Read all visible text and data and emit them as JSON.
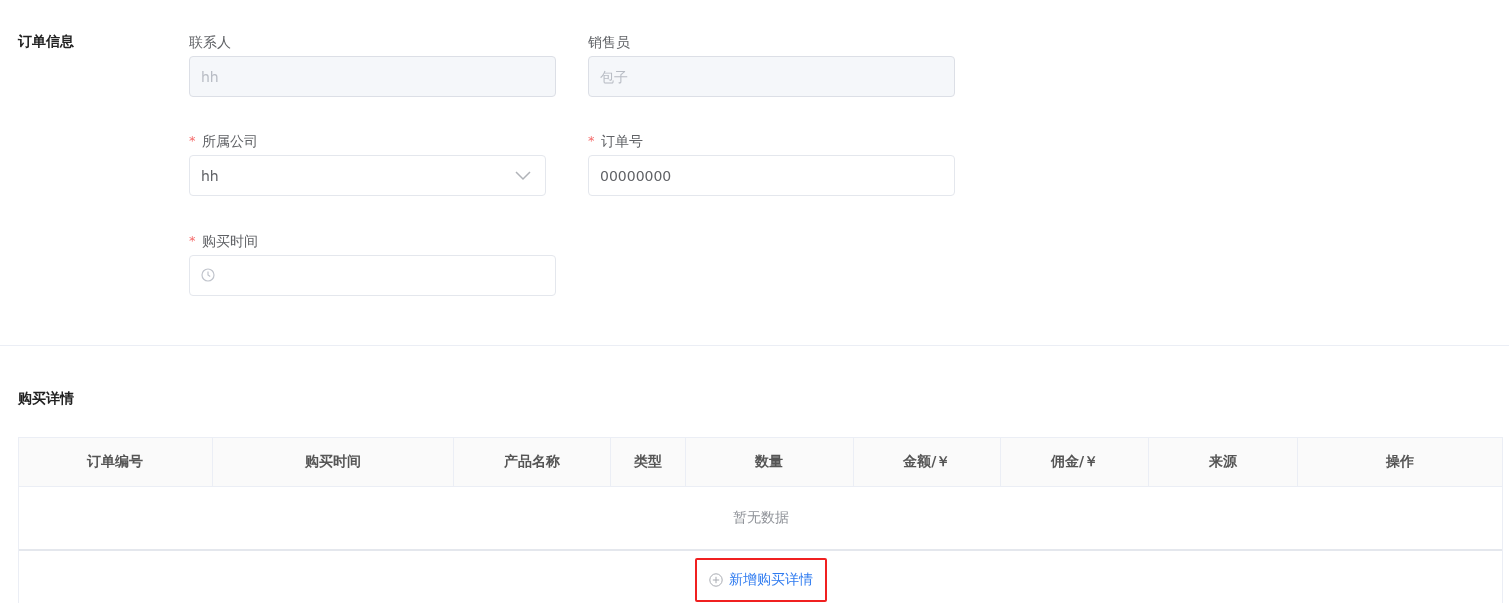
{
  "order_info": {
    "title": "订单信息",
    "fields": [
      {
        "label": "联系人",
        "kind": "input",
        "value": "hh",
        "disabled": true
      },
      {
        "label": "销售员",
        "kind": "input",
        "value": "包子",
        "disabled": true
      },
      {
        "label": "所属公司",
        "required_mark": "*",
        "kind": "select",
        "value": "hh"
      },
      {
        "label": "订单号",
        "required_mark": "*",
        "kind": "input",
        "value": "00000000"
      },
      {
        "label": "购买时间",
        "required_mark": "*",
        "kind": "date"
      }
    ]
  },
  "purchase_details": {
    "title": "购买详情",
    "table": {
      "columns": [
        "订单编号",
        "购买时间",
        "产品名称",
        "类型",
        "数量",
        "金额/￥",
        "佣金/￥",
        "来源",
        "操作"
      ],
      "empty_text": "暂无数据"
    },
    "add_button": {
      "label": "新增购买详情",
      "highlighted": true
    }
  }
}
